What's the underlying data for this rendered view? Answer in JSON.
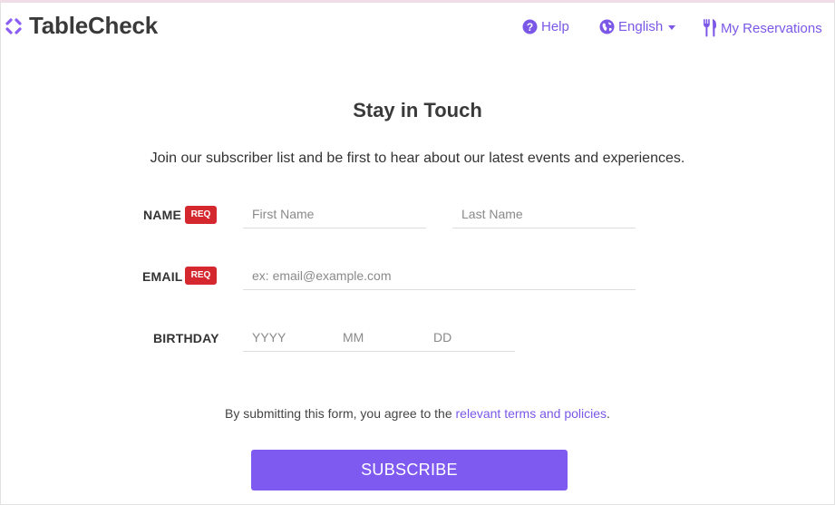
{
  "header": {
    "logo_text": "TableCheck",
    "help_label": "Help",
    "language_label": "English",
    "reservations_label": "My Reservations"
  },
  "form": {
    "title": "Stay in Touch",
    "subtitle": "Join our subscriber list and be first to hear about our latest events and experiences.",
    "name_label": "NAME",
    "email_label": "EMAIL",
    "birthday_label": "BIRTHDAY",
    "req_badge": "REQ",
    "first_name_placeholder": "First Name",
    "last_name_placeholder": "Last Name",
    "email_placeholder": "ex: email@example.com",
    "year_placeholder": "YYYY",
    "month_placeholder": "MM",
    "day_placeholder": "DD",
    "terms_prefix": "By submitting this form, you agree to the ",
    "terms_link": "relevant terms and policies",
    "terms_suffix": ".",
    "subscribe_label": "SUBSCRIBE"
  },
  "colors": {
    "accent": "#7f5af0",
    "link": "#7b57e8",
    "required": "#d4282e"
  },
  "icons": [
    "tablecheck-logo-icon",
    "help-icon",
    "globe-icon",
    "chevron-down-icon",
    "utensils-icon"
  ]
}
